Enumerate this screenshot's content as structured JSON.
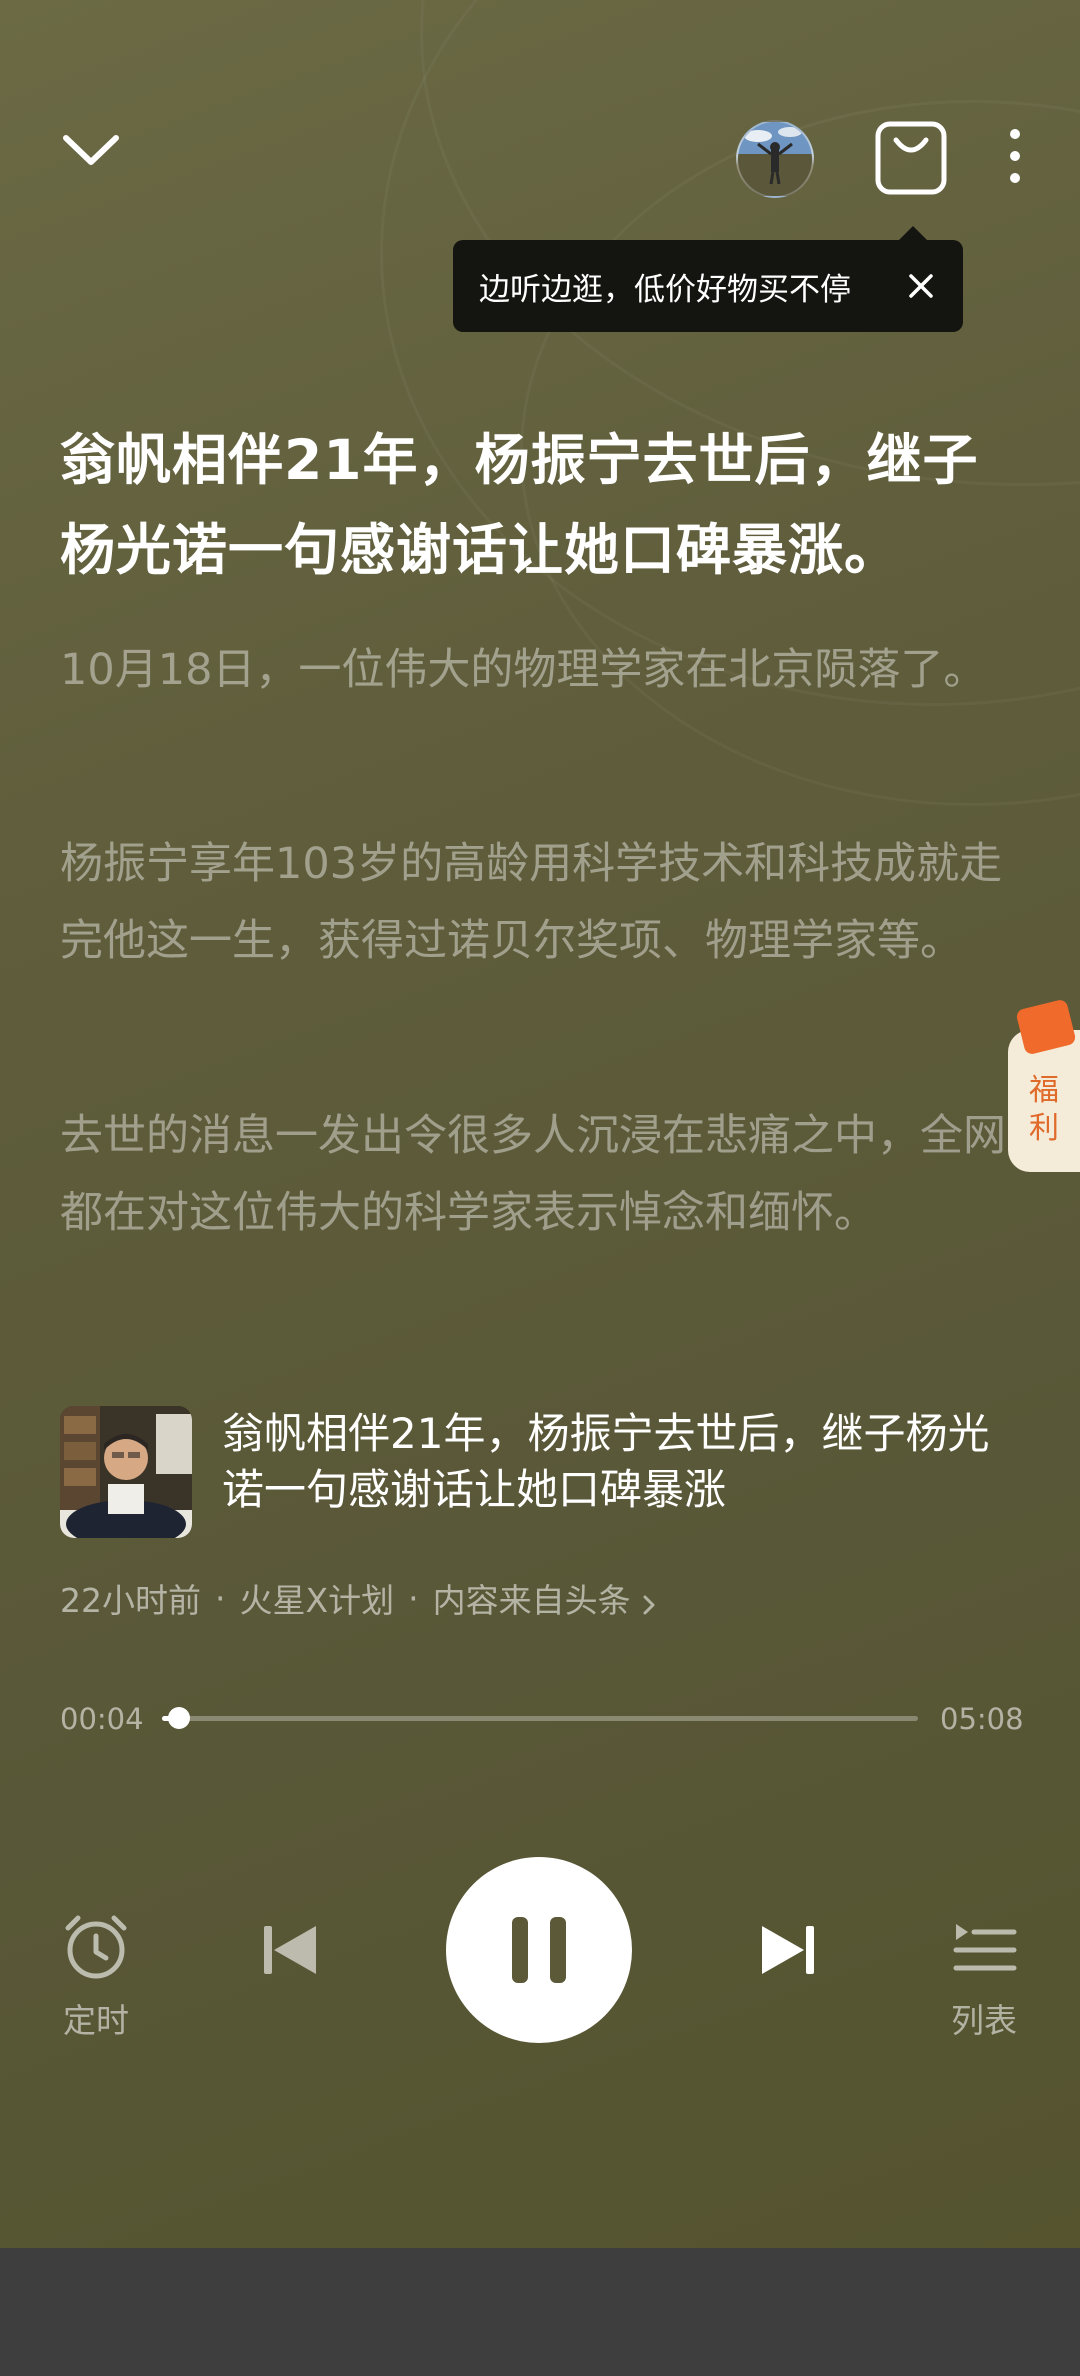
{
  "header": {
    "back_icon": "chevron-down-icon",
    "avatar_icon": "avatar",
    "shop_icon": "shopping-bag-icon",
    "more_icon": "more-vertical-icon"
  },
  "tooltip": {
    "text": "边听边逛，低价好物买不停",
    "close_icon": "close-icon"
  },
  "article": {
    "title": "翁帆相伴21年，杨振宁去世后，继子杨光诺一句感谢话让她口碑暴涨。",
    "paragraphs": [
      "10月18日，一位伟大的物理学家在北京陨落了。",
      "杨振宁享年103岁的高龄用科学技术和科技成就走完他这一生，获得过诺贝尔奖项、物理学家等。",
      "去世的消息一发出令很多人沉浸在悲痛之中，全网都在对这位伟大的科学家表示悼念和缅怀。"
    ]
  },
  "welfare": {
    "label_line1": "福",
    "label_line2": "利",
    "color": "#e06a2a"
  },
  "source_card": {
    "title": "翁帆相伴21年，杨振宁去世后，继子杨光诺一句感谢话让她口碑暴涨",
    "time": "22小时前",
    "author": "火星X计划",
    "source": "内容来自头条",
    "separator": "·"
  },
  "player": {
    "current_time": "00:04",
    "total_time": "05:08",
    "progress": 0.013,
    "timer_label": "定时",
    "list_label": "列表",
    "timer_icon": "alarm-clock-icon",
    "prev_icon": "skip-previous-icon",
    "pause_icon": "pause-icon",
    "next_icon": "skip-next-icon",
    "list_icon": "playlist-icon"
  }
}
